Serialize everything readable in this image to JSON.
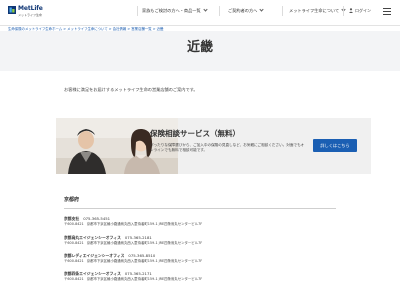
{
  "header": {
    "logo_text": "MetLife",
    "logo_sub": "メットライフ生命",
    "nav": [
      {
        "label": "家族もご検討の方へ・商品一覧"
      },
      {
        "label": "ご契約者の方へ"
      },
      {
        "label": "メットライフ生命について"
      }
    ],
    "login_label": "ログイン"
  },
  "breadcrumb": "生命保険のメットライフ生命ホーム > メットライフ生命について > 会社情報 > 営業店舗一覧 > 近畿",
  "page_title": "近畿",
  "intro": "お客様に満足をお届けするメットライフ生命の営業店舗のご案内です。",
  "banner": {
    "title": "保険相談サービス（無料）",
    "desc": "ぴったりな保障選びから、ご加入中の保険の見直しなど、お気軽にご相談ください。対面でもオンラインでも無料で相談可能です。",
    "button_label": "詳しくはこちら"
  },
  "region": "京都府",
  "offices": [
    {
      "name": "京都支社",
      "tel": "075-365-5451",
      "zip": "〒600-8421",
      "address": "京都市下京区綾小路通烏丸西入童侍者町159-1 JRE四条烏丸センタービル7F"
    },
    {
      "name": "京都烏丸エイジェンシーオフィス",
      "tel": "075-365-2181",
      "zip": "〒600-8421",
      "address": "京都市下京区綾小路通烏丸西入童侍者町159-1 JRE四条烏丸センタービル7F"
    },
    {
      "name": "京都レディエイジェンシーオフィス",
      "tel": "075-365-8510",
      "zip": "〒600-8421",
      "address": "京都市下京区綾小路通烏丸西入童侍者町159-1 JRE四条烏丸センタービル7F"
    },
    {
      "name": "京都四条エイジェンシーオフィス",
      "tel": "075-365-2171",
      "zip": "〒600-8421",
      "address": "京都市下京区綾小路通烏丸西入童侍者町159-1 JRE四条烏丸センタービル7F"
    }
  ],
  "colors": {
    "brand": "#0f3675",
    "link": "#1a5cb0",
    "button": "#1b5fb3",
    "title_band": "#f3f4f6"
  }
}
